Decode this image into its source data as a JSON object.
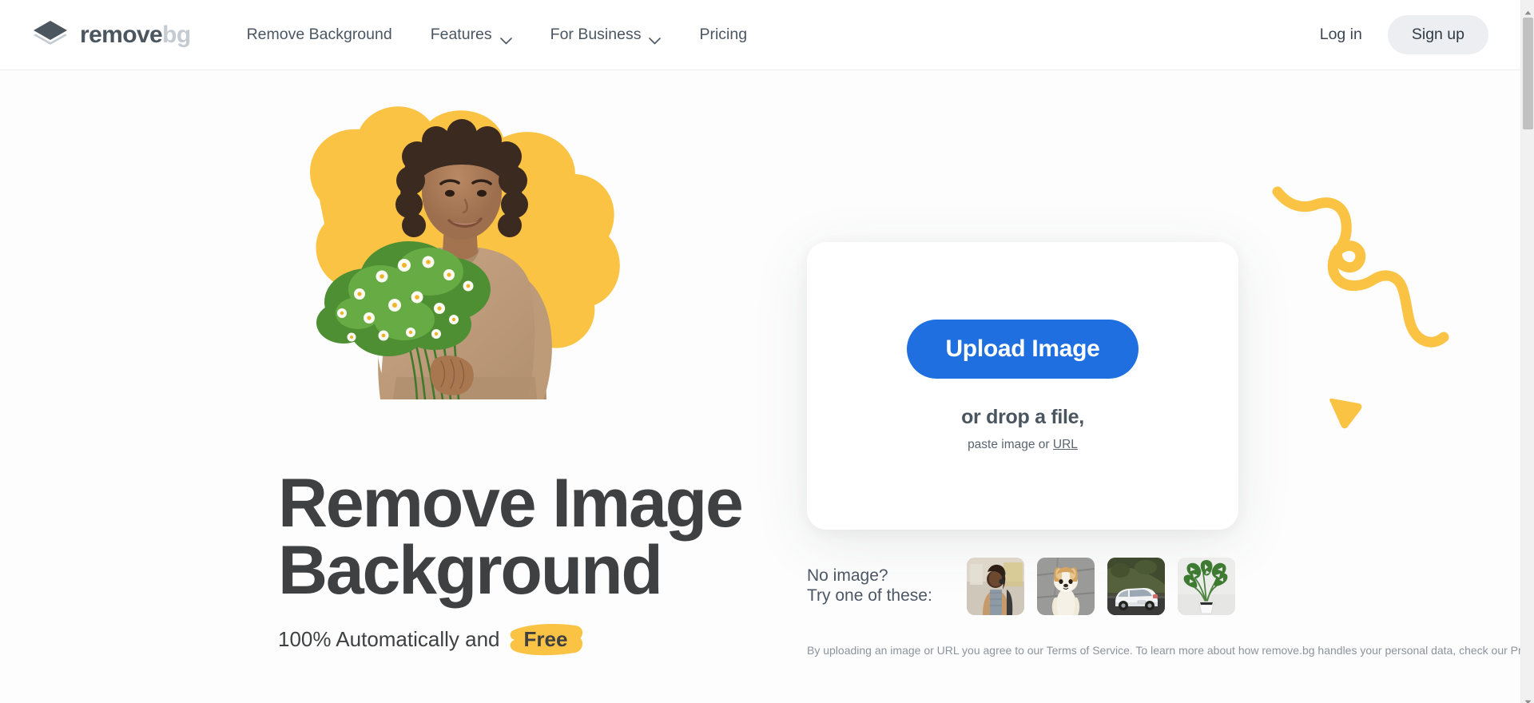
{
  "brand": {
    "name_primary": "remove",
    "name_secondary": "bg",
    "logo_icon": "layers-diamond-icon",
    "primary_color": "#4c565f",
    "secondary_color": "#c5cbd2"
  },
  "header": {
    "nav_items": [
      {
        "label": "Remove Background",
        "has_dropdown": false
      },
      {
        "label": "Features",
        "has_dropdown": true,
        "icon": "chevron-down-icon"
      },
      {
        "label": "For Business",
        "has_dropdown": true,
        "icon": "chevron-down-icon"
      },
      {
        "label": "Pricing",
        "has_dropdown": false
      }
    ],
    "login_label": "Log in",
    "signup_label": "Sign up"
  },
  "hero": {
    "title_line1": "Remove Image",
    "title_line2": "Background",
    "subtitle_prefix": "100% Automatically and",
    "subtitle_highlight": "Free",
    "highlight_color": "#FBC344",
    "photo_alt": "woman-with-flower-bouquet",
    "blob_color": "#FBC344"
  },
  "upload": {
    "button_label": "Upload Image",
    "button_color": "#1f6fe0",
    "drop_text": "or drop a file,",
    "paste_prefix": "paste image or",
    "paste_link": "URL"
  },
  "samples": {
    "label_line1": "No image?",
    "label_line2": "Try one of these:",
    "thumbnails": [
      {
        "name": "sample-person-on-phone"
      },
      {
        "name": "sample-corgi-dog"
      },
      {
        "name": "sample-white-car"
      },
      {
        "name": "sample-monstera-plant"
      }
    ],
    "footnote": "By uploading an image or URL you agree to our Terms of Service. To learn more about how remove.bg handles your personal data, check our Privacy Policy."
  },
  "decorations": {
    "squiggle": "yellow-squiggle-line",
    "triangle": "yellow-down-triangle",
    "color": "#FBC344"
  },
  "scrollbar": {
    "up_icon": "scroll-up-arrow-icon",
    "down_icon": "scroll-down-arrow-icon"
  }
}
